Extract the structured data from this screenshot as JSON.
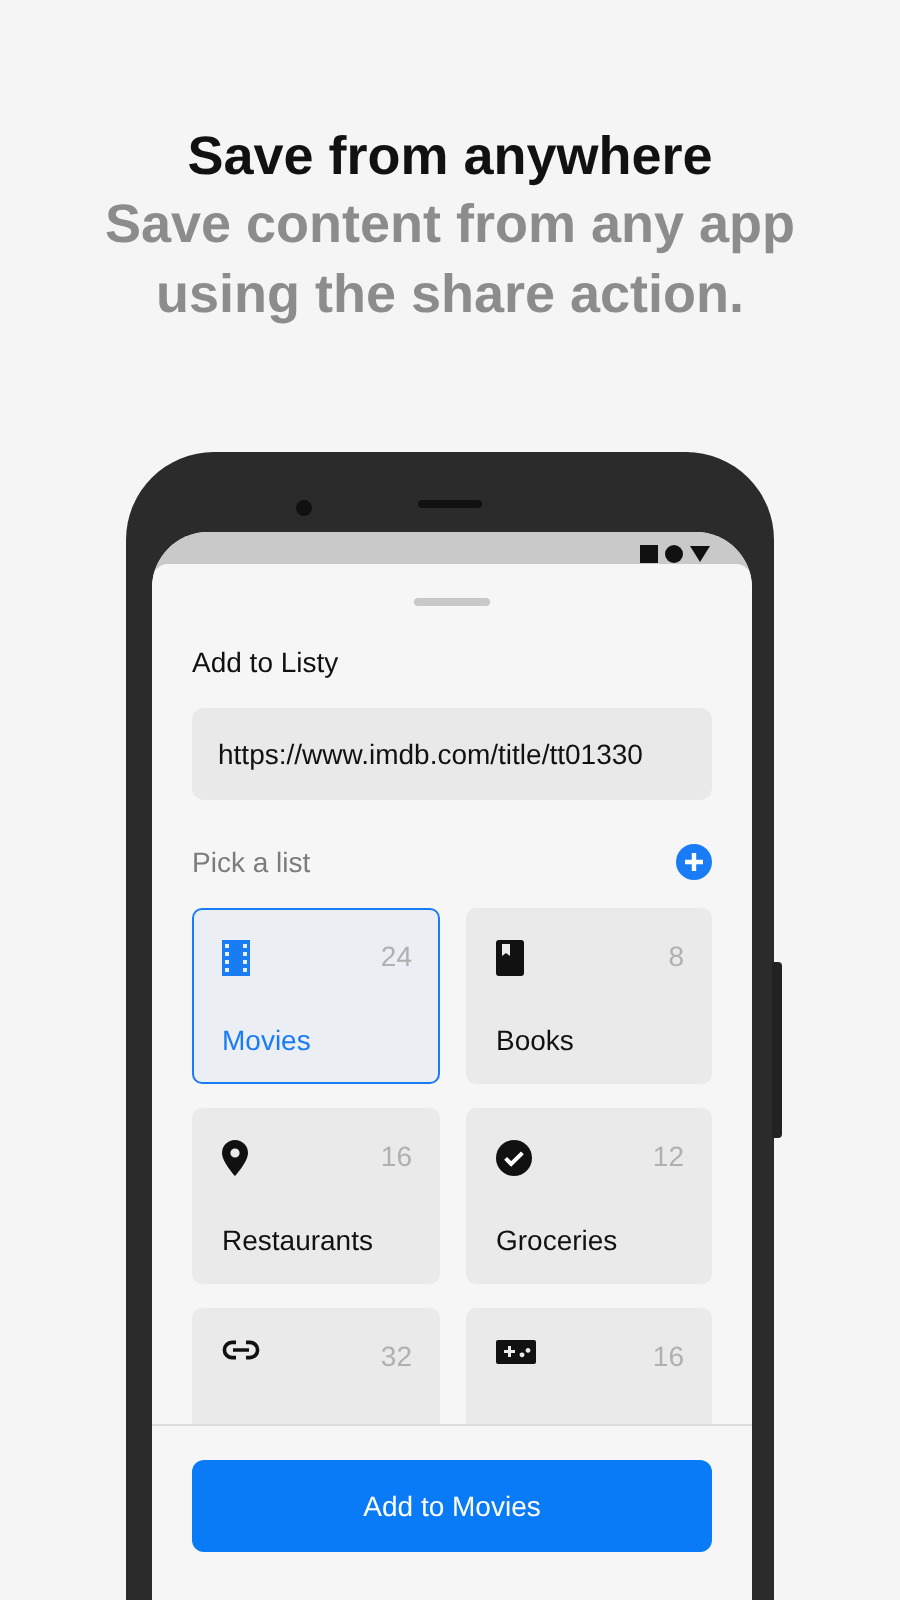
{
  "headline": "Save from anywhere",
  "subheadline": "Save content from any app using the share action.",
  "sheet": {
    "title": "Add to Listy",
    "url_field": {
      "value": "https://www.imdb.com/title/tt01330"
    },
    "section_label": "Pick a list"
  },
  "lists": [
    {
      "kind": "film",
      "count": "24",
      "name": "Movies",
      "selected": true
    },
    {
      "kind": "book",
      "count": "8",
      "name": "Books",
      "selected": false
    },
    {
      "kind": "pin",
      "count": "16",
      "name": "Restaurants",
      "selected": false
    },
    {
      "kind": "check",
      "count": "12",
      "name": "Groceries",
      "selected": false
    },
    {
      "kind": "link",
      "count": "32",
      "selected": false
    },
    {
      "kind": "gamepad",
      "count": "16",
      "selected": false
    }
  ],
  "primary_button": "Add to Movies"
}
